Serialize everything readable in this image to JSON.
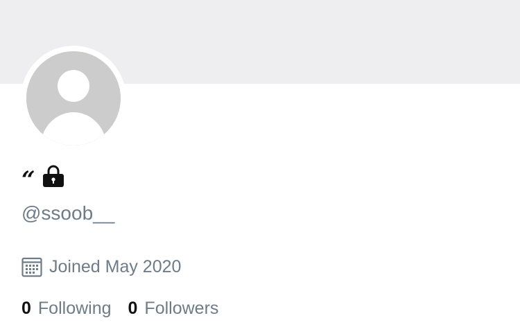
{
  "colors": {
    "banner_bg": "#eeeef0",
    "avatar_placeholder": "#cccccc",
    "text_primary": "#111111",
    "text_secondary": "#6e7b88"
  },
  "profile": {
    "display_name": "“",
    "protected_icon": "lock-icon",
    "handle": "@ssoob__",
    "joined_icon": "calendar-icon",
    "joined_text": "Joined May 2020"
  },
  "stats": {
    "following_count": "0",
    "following_label": "Following",
    "followers_count": "0",
    "followers_label": "Followers"
  }
}
